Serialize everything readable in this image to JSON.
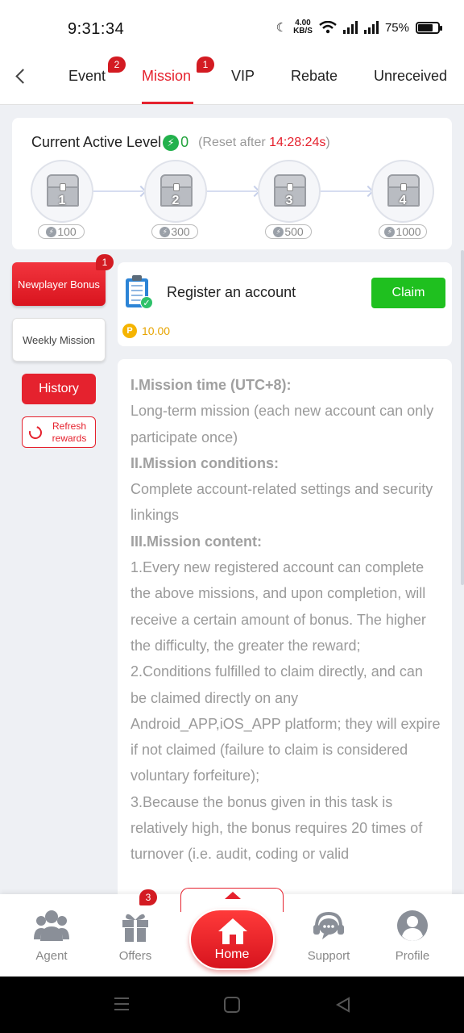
{
  "status": {
    "time": "9:31:34",
    "speed_value": "4.00",
    "speed_unit": "KB/S",
    "battery": "75%",
    "battery_level": 0.75
  },
  "tabs": [
    {
      "label": "Event",
      "badge": "2"
    },
    {
      "label": "Mission",
      "badge": "1",
      "active": true
    },
    {
      "label": "VIP"
    },
    {
      "label": "Rebate"
    },
    {
      "label": "Unreceived"
    }
  ],
  "level": {
    "title": "Current Active Level",
    "value": "0",
    "reset_prefix": "(Reset after ",
    "reset_time": "14:28:24s",
    "reset_suffix": ")",
    "chests": [
      {
        "num": "1",
        "points": "100"
      },
      {
        "num": "2",
        "points": "300"
      },
      {
        "num": "3",
        "points": "500"
      },
      {
        "num": "4",
        "points": "1000"
      }
    ]
  },
  "sidebar": {
    "newplayer": "Newplayer Bonus",
    "newplayer_badge": "1",
    "weekly": "Weekly Mission",
    "history": "History",
    "refresh": "Refresh rewards"
  },
  "mission": {
    "title": "Register an account",
    "claim": "Claim",
    "reward": "10.00"
  },
  "rules": {
    "h1": "I.Mission time (UTC+8):",
    "p1": "Long-term mission (each new account can only participate once)",
    "h2": "II.Mission conditions:",
    "p2": "Complete account-related settings and security linkings",
    "h3": "III.Mission content:",
    "p3": "1.Every new registered account can complete the above missions, and upon completion, will receive a certain amount of bonus. The higher the difficulty, the greater the reward;",
    "p4": "2.Conditions fulfilled to claim directly, and can be claimed directly on any Android_APP,iOS_APP platform; they will expire if not claimed (failure to claim is considered voluntary forfeiture);",
    "p5": "3.Because the bonus given in this task is relatively high, the bonus requires 20 times of turnover (i.e. audit, coding or valid"
  },
  "bottomnav": {
    "agent": "Agent",
    "offers": "Offers",
    "offers_badge": "3",
    "home": "Home",
    "support": "Support",
    "profile": "Profile"
  },
  "colors": {
    "accent": "#e5222e",
    "claim": "#1fc01f",
    "level_green": "#22a33c",
    "coin": "#f5b400"
  }
}
